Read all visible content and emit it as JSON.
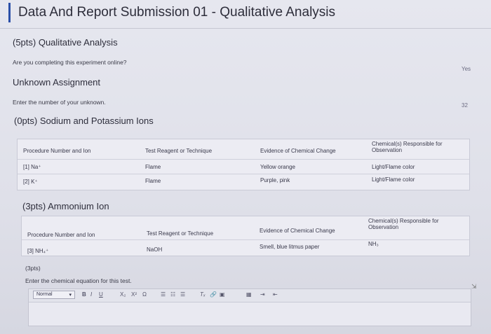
{
  "page": {
    "title": "Data And Report Submission 01 - Qualitative Analysis"
  },
  "qualitative": {
    "heading": "(5pts) Qualitative Analysis",
    "question": "Are you completing this experiment online?",
    "answer": "Yes"
  },
  "unknown": {
    "heading": "Unknown Assignment",
    "question": "Enter the number of your unknown.",
    "answer": "32"
  },
  "sodium_potassium": {
    "heading": "(0pts) Sodium and Potassium Ions",
    "headers": [
      "Procedure Number and Ion",
      "Test Reagent or Technique",
      "Evidence of Chemical Change",
      "Chemical(s) Responsible for Observation"
    ],
    "rows": [
      [
        "[1] Na⁺",
        "Flame",
        "Yellow orange",
        "Light/Flame color"
      ],
      [
        "[2] K⁺",
        "Flame",
        "Purple, pink",
        "Light/Flame color"
      ]
    ]
  },
  "ammonium": {
    "heading": "(3pts) Ammonium Ion",
    "headers": [
      "Procedure Number and Ion",
      "Test Reagent or Technique",
      "Evidence of Chemical Change",
      "Chemical(s) Responsible for Observation"
    ],
    "rows": [
      [
        "[3] NH₄⁺",
        "NaOH",
        "Smell, blue litmus paper",
        "NH₃"
      ]
    ]
  },
  "equation": {
    "points": "(3pts)",
    "question": "Enter the chemical equation for this test.",
    "toolbar": {
      "style_value": "Normal",
      "bold": "B",
      "italic": "I",
      "underline": "U",
      "subscript": "X₂",
      "superscript": "X²",
      "special_chars": "Ω",
      "list_ordered": "☰",
      "list_bullet": "☷",
      "align": "☰",
      "clear_format": "Tₓ",
      "link": "🔗",
      "image": "▣",
      "table": "▦",
      "indent": "⇥",
      "outdent": "⇤"
    }
  }
}
